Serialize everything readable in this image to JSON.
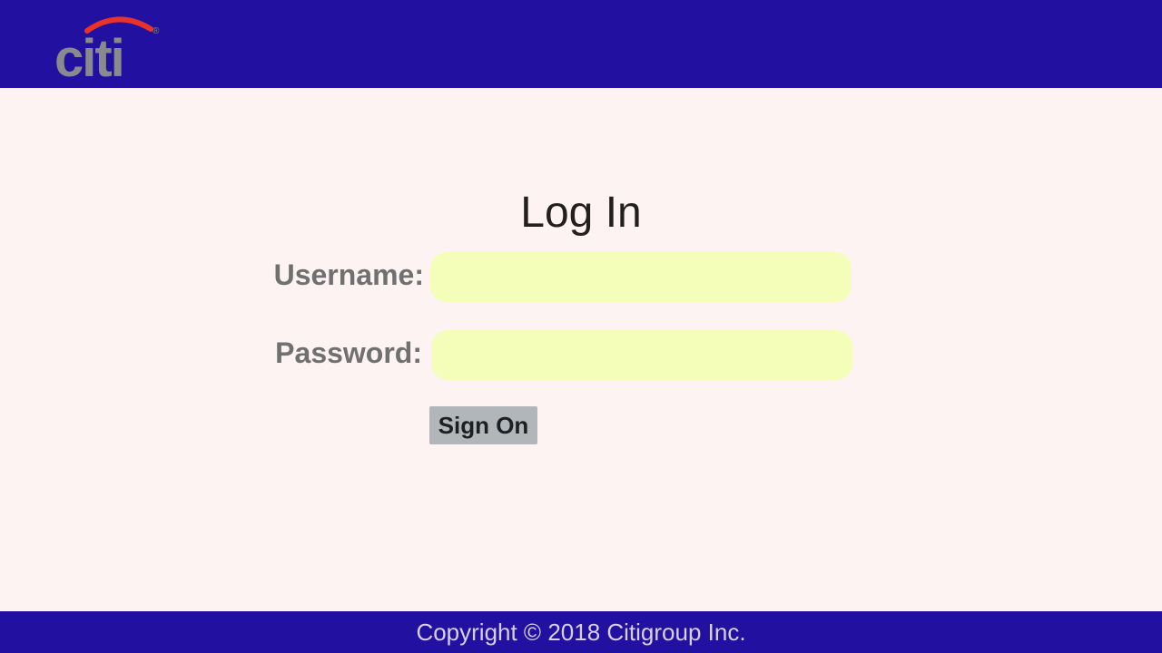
{
  "header": {
    "logo_text": "citi",
    "logo_mark": "®",
    "colors": {
      "background": "#2211a0",
      "logo_arc": "#e8332a",
      "logo_text": "#8a8a8e"
    }
  },
  "login": {
    "title": "Log In",
    "username_label": "Username:",
    "username_value": "",
    "password_label": "Password:",
    "password_value": "",
    "submit_label": "Sign On",
    "colors": {
      "input_background": "#f5feb8",
      "button_background": "#b0b6ba",
      "page_background": "#fdf3f2"
    }
  },
  "footer": {
    "copyright": "Copyright © 2018 Citigroup Inc.",
    "colors": {
      "background": "#2211a0",
      "text": "#d7d0e6"
    }
  }
}
